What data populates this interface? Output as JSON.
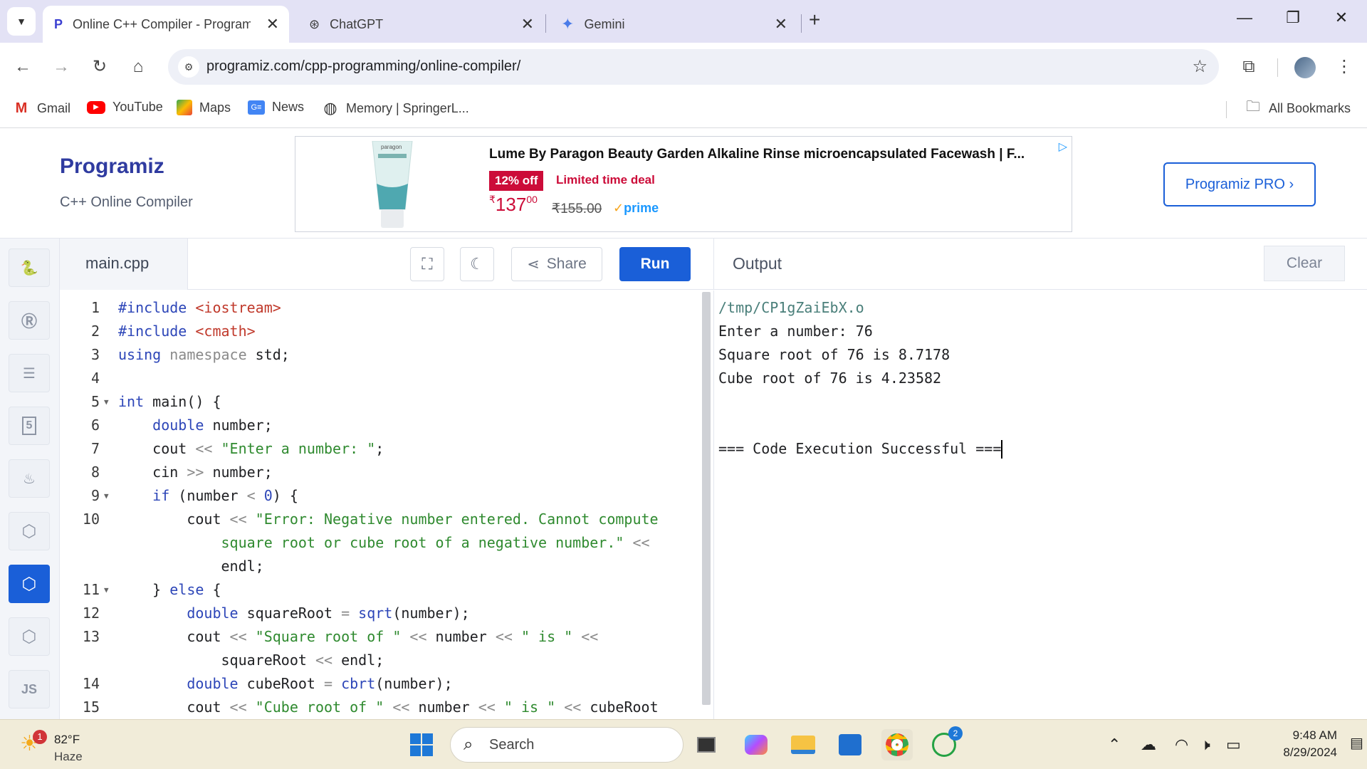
{
  "browser": {
    "tabs": [
      {
        "title": "Online C++ Compiler - Program",
        "active": true
      },
      {
        "title": "ChatGPT",
        "active": false
      },
      {
        "title": "Gemini",
        "active": false
      }
    ],
    "url": "programiz.com/cpp-programming/online-compiler/",
    "bookmarks": [
      {
        "label": "Gmail",
        "icon": "gmail-icon"
      },
      {
        "label": "YouTube",
        "icon": "youtube-icon"
      },
      {
        "label": "Maps",
        "icon": "maps-icon"
      },
      {
        "label": "News",
        "icon": "news-icon"
      },
      {
        "label": "Memory | SpringerL...",
        "icon": "globe-icon"
      }
    ],
    "all_bookmarks": "All Bookmarks"
  },
  "site": {
    "logo": "Programiz",
    "subtitle": "C++ Online Compiler",
    "pro_button": "Programiz PRO ›",
    "ad": {
      "title": "Lume By Paragon Beauty Garden Alkaline Rinse microencapsulated Facewash | F...",
      "badge": "12% off",
      "deal": "Limited time deal",
      "price_symbol": "₹",
      "price_main": "137",
      "price_fraction": "00",
      "old_price": "₹155.00",
      "prime": "prime",
      "product_brand": "paragon"
    }
  },
  "editor": {
    "filename": "main.cpp",
    "share_label": "Share",
    "run_label": "Run",
    "lines": [
      {
        "n": "1",
        "fold": false,
        "tokens": [
          [
            "inc-kw",
            "#include "
          ],
          [
            "inc",
            "<iostream>"
          ]
        ]
      },
      {
        "n": "2",
        "fold": false,
        "tokens": [
          [
            "inc-kw",
            "#include "
          ],
          [
            "inc",
            "<cmath>"
          ]
        ]
      },
      {
        "n": "3",
        "fold": false,
        "tokens": [
          [
            "kw",
            "using "
          ],
          [
            "op",
            "namespace "
          ],
          [
            "t",
            "std;"
          ]
        ]
      },
      {
        "n": "4",
        "fold": false,
        "tokens": []
      },
      {
        "n": "5",
        "fold": true,
        "tokens": [
          [
            "kw",
            "int "
          ],
          [
            "t",
            "main() {"
          ]
        ]
      },
      {
        "n": "6",
        "fold": false,
        "tokens": [
          [
            "t",
            "    "
          ],
          [
            "kw",
            "double "
          ],
          [
            "t",
            "number;"
          ]
        ]
      },
      {
        "n": "7",
        "fold": false,
        "tokens": [
          [
            "t",
            "    cout "
          ],
          [
            "op",
            "<< "
          ],
          [
            "str",
            "\"Enter a number: \""
          ],
          [
            "t",
            ";"
          ]
        ]
      },
      {
        "n": "8",
        "fold": false,
        "tokens": [
          [
            "t",
            "    cin "
          ],
          [
            "op",
            ">> "
          ],
          [
            "t",
            "number;"
          ]
        ]
      },
      {
        "n": "9",
        "fold": true,
        "tokens": [
          [
            "t",
            "    "
          ],
          [
            "kw",
            "if "
          ],
          [
            "t",
            "(number "
          ],
          [
            "op",
            "< "
          ],
          [
            "kw",
            "0"
          ],
          [
            "t",
            ") {"
          ]
        ]
      },
      {
        "n": "10",
        "fold": false,
        "tokens": [
          [
            "t",
            "        cout "
          ],
          [
            "op",
            "<< "
          ],
          [
            "str",
            "\"Error: Negative number entered. Cannot compute"
          ]
        ]
      },
      {
        "n": "",
        "fold": false,
        "tokens": [
          [
            "str",
            "            square root or cube root of a negative number.\""
          ],
          [
            "t",
            " "
          ],
          [
            "op",
            "<<"
          ]
        ]
      },
      {
        "n": "",
        "fold": false,
        "tokens": [
          [
            "t",
            "            endl;"
          ]
        ]
      },
      {
        "n": "11",
        "fold": true,
        "tokens": [
          [
            "t",
            "    } "
          ],
          [
            "kw",
            "else "
          ],
          [
            "t",
            "{"
          ]
        ]
      },
      {
        "n": "12",
        "fold": false,
        "tokens": [
          [
            "t",
            "        "
          ],
          [
            "kw",
            "double "
          ],
          [
            "t",
            "squareRoot "
          ],
          [
            "op",
            "= "
          ],
          [
            "fn",
            "sqrt"
          ],
          [
            "t",
            "(number);"
          ]
        ]
      },
      {
        "n": "13",
        "fold": false,
        "tokens": [
          [
            "t",
            "        cout "
          ],
          [
            "op",
            "<< "
          ],
          [
            "str",
            "\"Square root of \""
          ],
          [
            "t",
            " "
          ],
          [
            "op",
            "<< "
          ],
          [
            "t",
            "number "
          ],
          [
            "op",
            "<< "
          ],
          [
            "str",
            "\" is \""
          ],
          [
            "t",
            " "
          ],
          [
            "op",
            "<<"
          ]
        ]
      },
      {
        "n": "",
        "fold": false,
        "tokens": [
          [
            "t",
            "            squareRoot "
          ],
          [
            "op",
            "<< "
          ],
          [
            "t",
            "endl;"
          ]
        ]
      },
      {
        "n": "14",
        "fold": false,
        "tokens": [
          [
            "t",
            "        "
          ],
          [
            "kw",
            "double "
          ],
          [
            "t",
            "cubeRoot "
          ],
          [
            "op",
            "= "
          ],
          [
            "fn",
            "cbrt"
          ],
          [
            "t",
            "(number);"
          ]
        ]
      },
      {
        "n": "15",
        "fold": false,
        "tokens": [
          [
            "t",
            "        cout "
          ],
          [
            "op",
            "<< "
          ],
          [
            "str",
            "\"Cube root of \""
          ],
          [
            "t",
            " "
          ],
          [
            "op",
            "<< "
          ],
          [
            "t",
            "number "
          ],
          [
            "op",
            "<< "
          ],
          [
            "str",
            "\" is \""
          ],
          [
            "t",
            " "
          ],
          [
            "op",
            "<< "
          ],
          [
            "t",
            "cubeRoot"
          ]
        ]
      }
    ]
  },
  "output": {
    "title": "Output",
    "clear_label": "Clear",
    "lines": [
      "/tmp/CP1gZaiEbX.o",
      "Enter a number: 76",
      "Square root of 76 is 8.7178",
      "Cube root of 76 is 4.23582",
      "",
      "",
      "=== Code Execution Successful ==="
    ]
  },
  "languages": [
    "python-icon",
    "r-icon",
    "database-icon",
    "html5-icon",
    "java-icon",
    "c-icon",
    "cpp-icon",
    "csharp-icon",
    "js-icon"
  ],
  "languages_js_label": "JS",
  "taskbar": {
    "weather_temp": "82°F",
    "weather_desc": "Haze",
    "weather_badge": "1",
    "search_placeholder": "Search",
    "whatsapp_badge": "2",
    "time": "9:48 AM",
    "date": "8/29/2024"
  },
  "colors": {
    "accent": "#1a5fd8",
    "tab_strip": "#e3e2f5",
    "taskbar": "#f1ecd9",
    "string": "#2f8a2f",
    "keyword": "#2d46b8",
    "include": "#c0392b"
  }
}
